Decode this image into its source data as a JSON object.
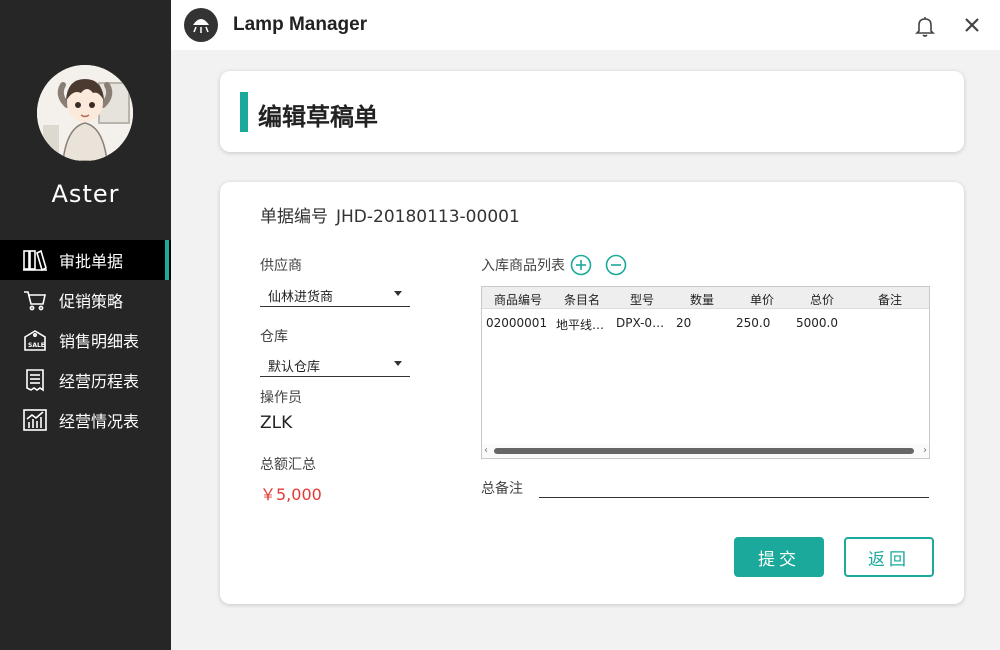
{
  "app": {
    "title": "Lamp Manager"
  },
  "user": {
    "name": "Aster"
  },
  "sidebar": {
    "items": [
      {
        "label": "审批单据",
        "icon": "books-icon",
        "active": true
      },
      {
        "label": "促销策略",
        "icon": "cart-icon",
        "active": false
      },
      {
        "label": "销售明细表",
        "icon": "sale-tag-icon",
        "active": false
      },
      {
        "label": "经营历程表",
        "icon": "receipt-icon",
        "active": false
      },
      {
        "label": "经营情况表",
        "icon": "chart-icon",
        "active": false
      }
    ]
  },
  "page": {
    "title": "编辑草稿单"
  },
  "form": {
    "doc_no_label": "单据编号",
    "doc_no": "JHD-20180113-00001",
    "supplier_label": "供应商",
    "supplier_value": "仙林进货商",
    "warehouse_label": "仓库",
    "warehouse_value": "默认仓库",
    "operator_label": "操作员",
    "operator_value": "ZLK",
    "total_label": "总额汇总",
    "total_value": "￥5,000",
    "list_title": "入库商品列表",
    "remark_label": "总备注",
    "remark_value": ""
  },
  "table": {
    "headers": [
      "商品编号",
      "条目名",
      "型号",
      "数量",
      "单价",
      "总价",
      "备注"
    ],
    "rows": [
      [
        "02000001",
        "地平线…",
        "DPX-0…",
        "20",
        "250.0",
        "5000.0",
        ""
      ]
    ]
  },
  "buttons": {
    "submit": "提交",
    "back": "返回"
  },
  "colors": {
    "accent": "#1aa99a",
    "sidebar_bg": "#262626",
    "total": "#e53935"
  }
}
